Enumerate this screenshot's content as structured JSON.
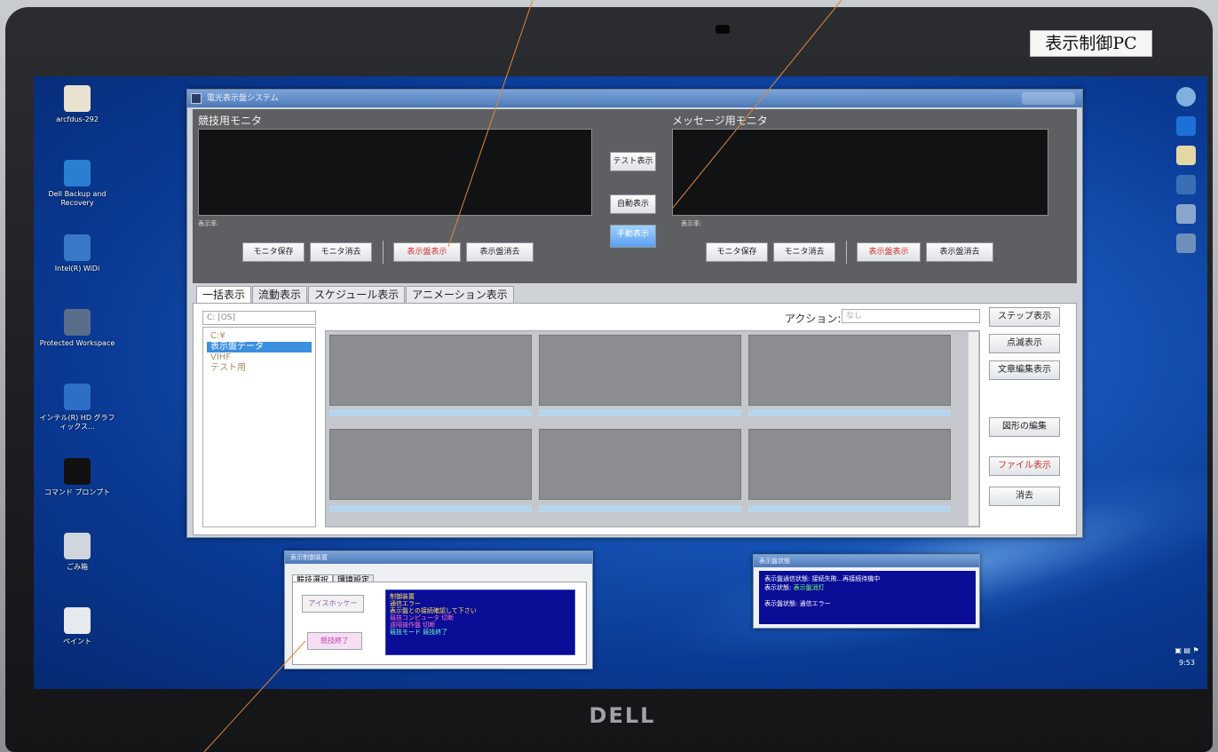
{
  "sticker": "表示制御PC",
  "laptop_brand": "DELL",
  "desktop_icons": [
    {
      "label": "arcfdus-292",
      "icon": "folder-icon",
      "color": "#e8e2d0"
    },
    {
      "label": "Dell Backup and Recovery",
      "icon": "backup-icon",
      "color": "#2a7fd0"
    },
    {
      "label": "Intel(R) WiDi",
      "icon": "widi-icon",
      "color": "#3a78c8"
    },
    {
      "label": "Protected Workspace",
      "icon": "shield-icon",
      "color": "#5a6d8a"
    },
    {
      "label": "インテル(R) HD グラフィックス...",
      "icon": "graphics-icon",
      "color": "#2d6ec6"
    },
    {
      "label": "コマンド プロンプト",
      "icon": "terminal-icon",
      "color": "#111111"
    },
    {
      "label": "ごみ箱",
      "icon": "trash-icon",
      "color": "#cfd6dd"
    },
    {
      "label": "ペイント",
      "icon": "paint-icon",
      "color": "#e6e9ee"
    }
  ],
  "tray_time": "9:53",
  "main_window": {
    "title": "電光表示盤システム",
    "left_monitor": {
      "label": "競技用モニタ",
      "caption": "表示率:",
      "buttons": [
        "モニタ保存",
        "モニタ消去",
        "表示盤表示",
        "表示盤消去"
      ]
    },
    "center_buttons": [
      "テスト表示",
      "自動表示",
      "手動表示"
    ],
    "right_monitor": {
      "label": "メッセージ用モニタ",
      "caption": "表示率:",
      "buttons": [
        "モニタ保存",
        "モニタ消去",
        "表示盤表示",
        "表示盤消去"
      ]
    },
    "tabs": [
      "一括表示",
      "流動表示",
      "スケジュール表示",
      "アニメーション表示"
    ],
    "drive": "C: [OS]",
    "tree": [
      "C:¥",
      "表示盤データ",
      "VIHF",
      "テスト用"
    ],
    "action_label": "アクション:",
    "action_value": "なし",
    "side_buttons": [
      "ステップ表示",
      "点滅表示",
      "文章編集表示",
      "図形の編集",
      "ファイル表示",
      "消去"
    ]
  },
  "dialog1": {
    "title": "表示制御装置",
    "tabs": [
      "競技選択",
      "環境設定"
    ],
    "button1": "アイスホッケー",
    "button2": "競技終了",
    "status_lines": [
      {
        "text": "制御装置",
        "style": "yellow"
      },
      {
        "text": "通信エラー",
        "style": "yellow"
      },
      {
        "text": "表示盤との接続確認して下さい",
        "style": "yellow"
      },
      {
        "text": "競技コンピュータ 切断",
        "style": "pink"
      },
      {
        "text": "遠隔操作盤 切断",
        "style": "pink"
      },
      {
        "text": "競技モード 競技終了",
        "style": "cyan"
      }
    ]
  },
  "dialog2": {
    "title": "表示盤状態",
    "line1": "表示盤通信状態: 接続失敗...再接続待機中",
    "line2_label": "表示状態:",
    "line2_value": "表示盤消灯",
    "line3": "表示盤状態: 通信エラー"
  }
}
